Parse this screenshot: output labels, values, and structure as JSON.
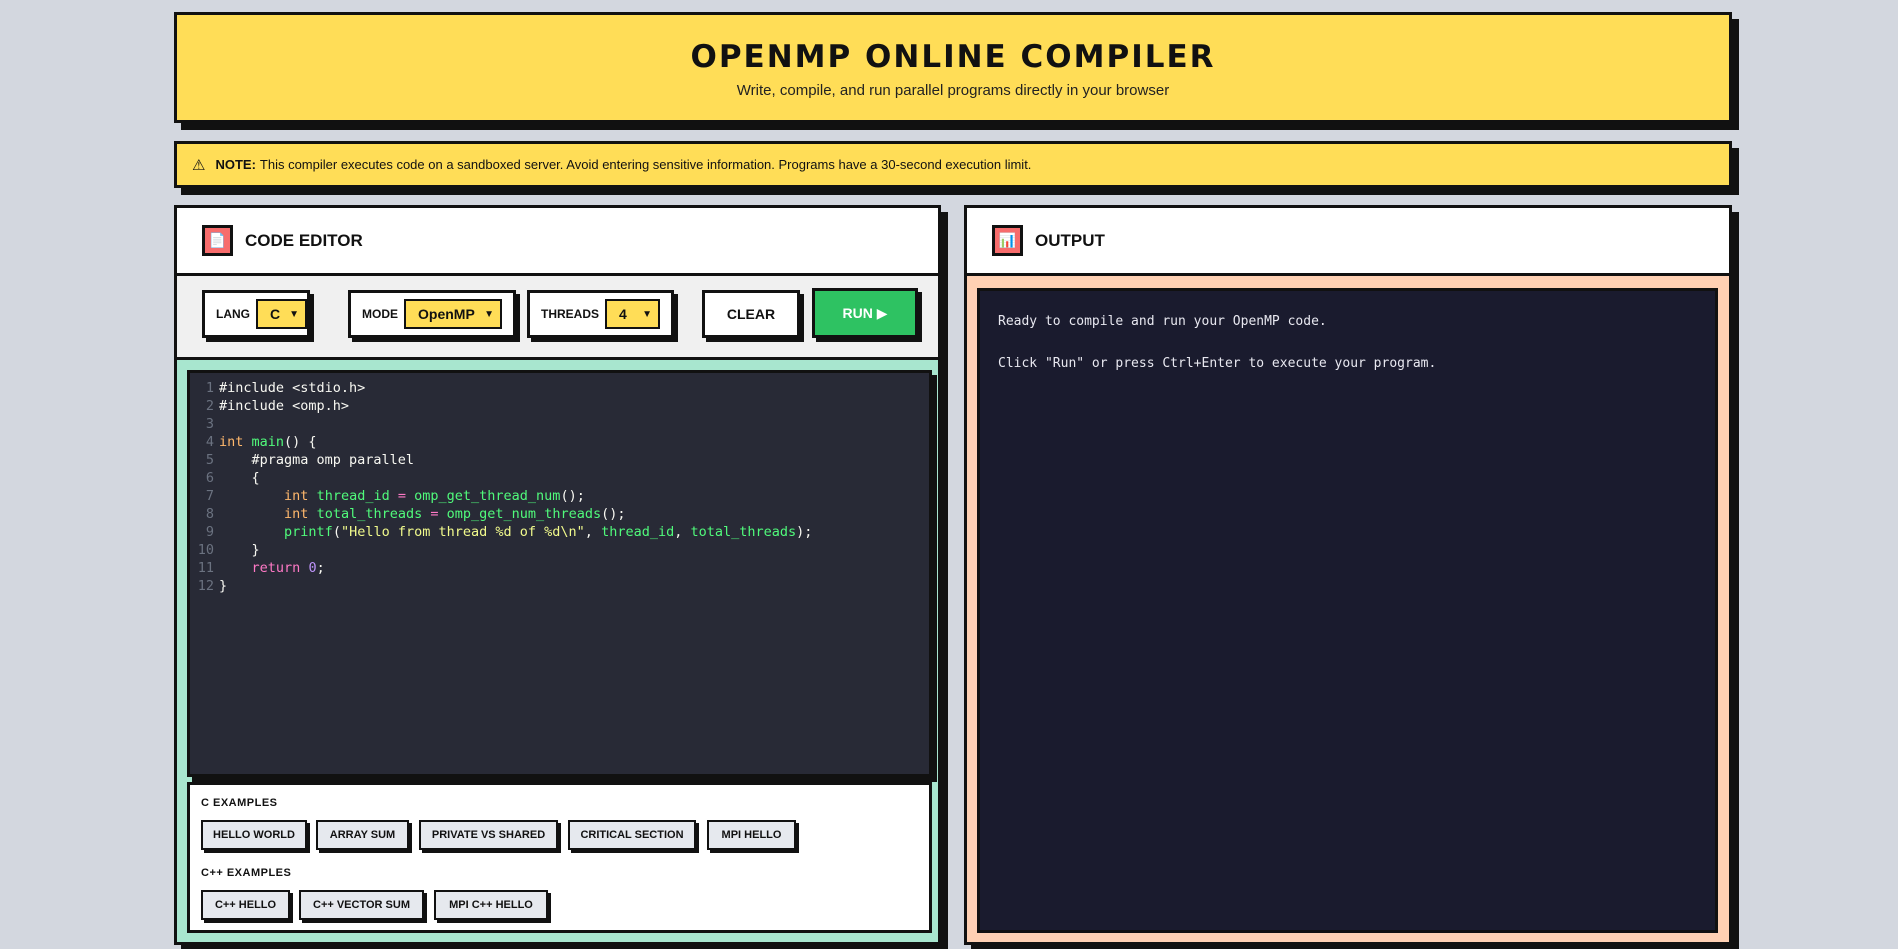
{
  "header": {
    "title": "OPENMP ONLINE COMPILER",
    "subtitle": "Write, compile, and run parallel programs directly in your browser"
  },
  "note": {
    "icon": "warning-icon",
    "label": "NOTE:",
    "text": "This compiler executes code on a sandboxed server. Avoid entering sensitive information. Programs have a 30-second execution limit."
  },
  "editor": {
    "title": "CODE EDITOR",
    "icon": "document-icon",
    "lang_label": "LANG",
    "lang_value": "C",
    "mode_label": "MODE",
    "mode_value": "OpenMP",
    "threads_label": "THREADS",
    "threads_value": "4",
    "clear_label": "CLEAR",
    "run_label": "RUN ▶",
    "line_numbers": [
      "1",
      "2",
      "3",
      "4",
      "5",
      "6",
      "7",
      "8",
      "9",
      "10",
      "11",
      "12"
    ],
    "code_lines": [
      "#include <stdio.h>",
      "#include <omp.h>",
      "",
      "int main() {",
      "    #pragma omp parallel",
      "    {",
      "        int thread_id = omp_get_thread_num();",
      "        int total_threads = omp_get_num_threads();",
      "        printf(\"Hello from thread %d of %d\\n\", thread_id, total_threads);",
      "    }",
      "    return 0;",
      "}"
    ]
  },
  "examples": {
    "c_title": "C EXAMPLES",
    "c_items": [
      "HELLO WORLD",
      "ARRAY SUM",
      "PRIVATE VS SHARED",
      "CRITICAL SECTION",
      "MPI HELLO"
    ],
    "cpp_title": "C++ EXAMPLES",
    "cpp_items": [
      "C++ HELLO",
      "C++ VECTOR SUM",
      "MPI C++ HELLO"
    ]
  },
  "output": {
    "title": "OUTPUT",
    "icon": "bar-chart-icon",
    "line1": "Ready to compile and run your OpenMP code.",
    "line2": "Click \"Run\" or press Ctrl+Enter to execute your program."
  },
  "colors": {
    "yellow": "#ffdd57",
    "mint": "#a8e6cf",
    "peach": "#ffd0b3",
    "green": "#2ec262",
    "red": "#f76c6c",
    "code_bg": "#282a36",
    "output_bg": "#1a1b2e"
  }
}
